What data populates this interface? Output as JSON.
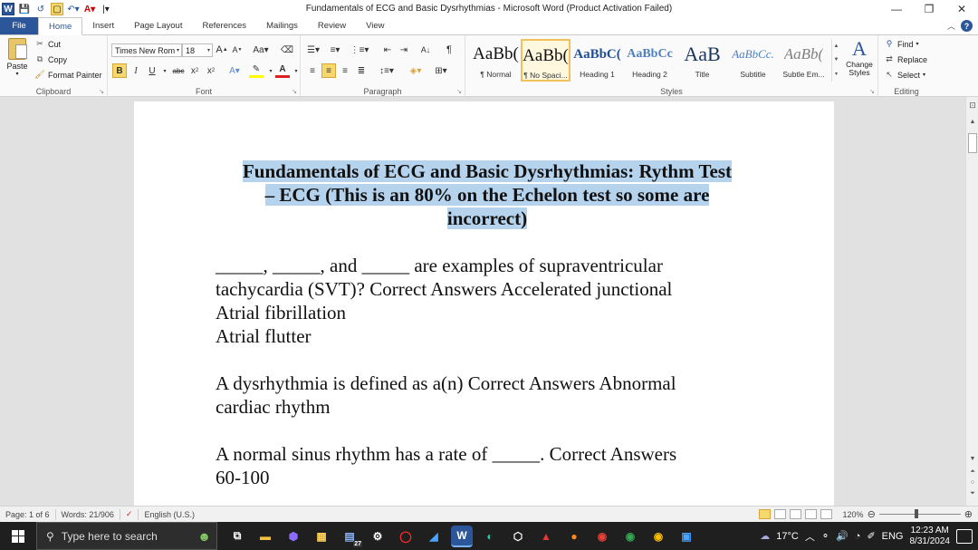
{
  "window": {
    "title": "Fundamentals of ECG and Basic Dysrhythmias  -  Microsoft Word (Product Activation Failed)",
    "controls": [
      "—",
      "❐",
      "✕"
    ]
  },
  "tabs": [
    "File",
    "Home",
    "Insert",
    "Page Layout",
    "References",
    "Mailings",
    "Review",
    "View"
  ],
  "ribbon": {
    "clipboard": {
      "paste": "Paste",
      "cut": "Cut",
      "copy": "Copy",
      "format_painter": "Format Painter",
      "label": "Clipboard"
    },
    "font": {
      "font_name": "Times New Rom",
      "font_size": "18",
      "label": "Font"
    },
    "paragraph": {
      "label": "Paragraph"
    },
    "styles": {
      "label": "Styles",
      "items": [
        {
          "sample": "AaBb(",
          "name": "¶ Normal"
        },
        {
          "sample": "AaBb(",
          "name": "¶ No Spaci..."
        },
        {
          "sample": "AaBbC(",
          "name": "Heading 1"
        },
        {
          "sample": "AaBbCc",
          "name": "Heading 2"
        },
        {
          "sample": "AaB",
          "name": "Title"
        },
        {
          "sample": "AaBbCc.",
          "name": "Subtitle"
        },
        {
          "sample": "AaBb(",
          "name": "Subtle Em..."
        }
      ],
      "change_styles": "Change Styles"
    },
    "editing": {
      "label": "Editing",
      "find": "Find",
      "replace": "Replace",
      "select": "Select"
    }
  },
  "document": {
    "heading_lines": [
      "Fundamentals of ECG and Basic Dysrhythmias: Rythm Test",
      "– ECG (This is an 80% on the Echelon test so some are",
      "incorrect)"
    ],
    "q1": [
      "_____, _____, and _____ are examples of supraventricular",
      "tachycardia (SVT)?  Correct Answers  Accelerated junctional",
      "Atrial fibrillation",
      "Atrial flutter"
    ],
    "q2": [
      "A dysrhythmia is defined as a(n)  Correct Answers  Abnormal",
      "cardiac rhythm"
    ],
    "q3": [
      "A normal sinus rhythm has a rate of _____.  Correct Answers",
      "60-100"
    ]
  },
  "status": {
    "page": "Page: 1 of 6",
    "words": "Words: 21/906",
    "language": "English (U.S.)",
    "zoom": "120%",
    "zoom_level": 0.45
  },
  "taskbar": {
    "search_placeholder": "Type here to search",
    "temperature": "17°C",
    "language": "ENG",
    "time": "12:23 AM",
    "date": "8/31/2024",
    "badge": "27"
  }
}
